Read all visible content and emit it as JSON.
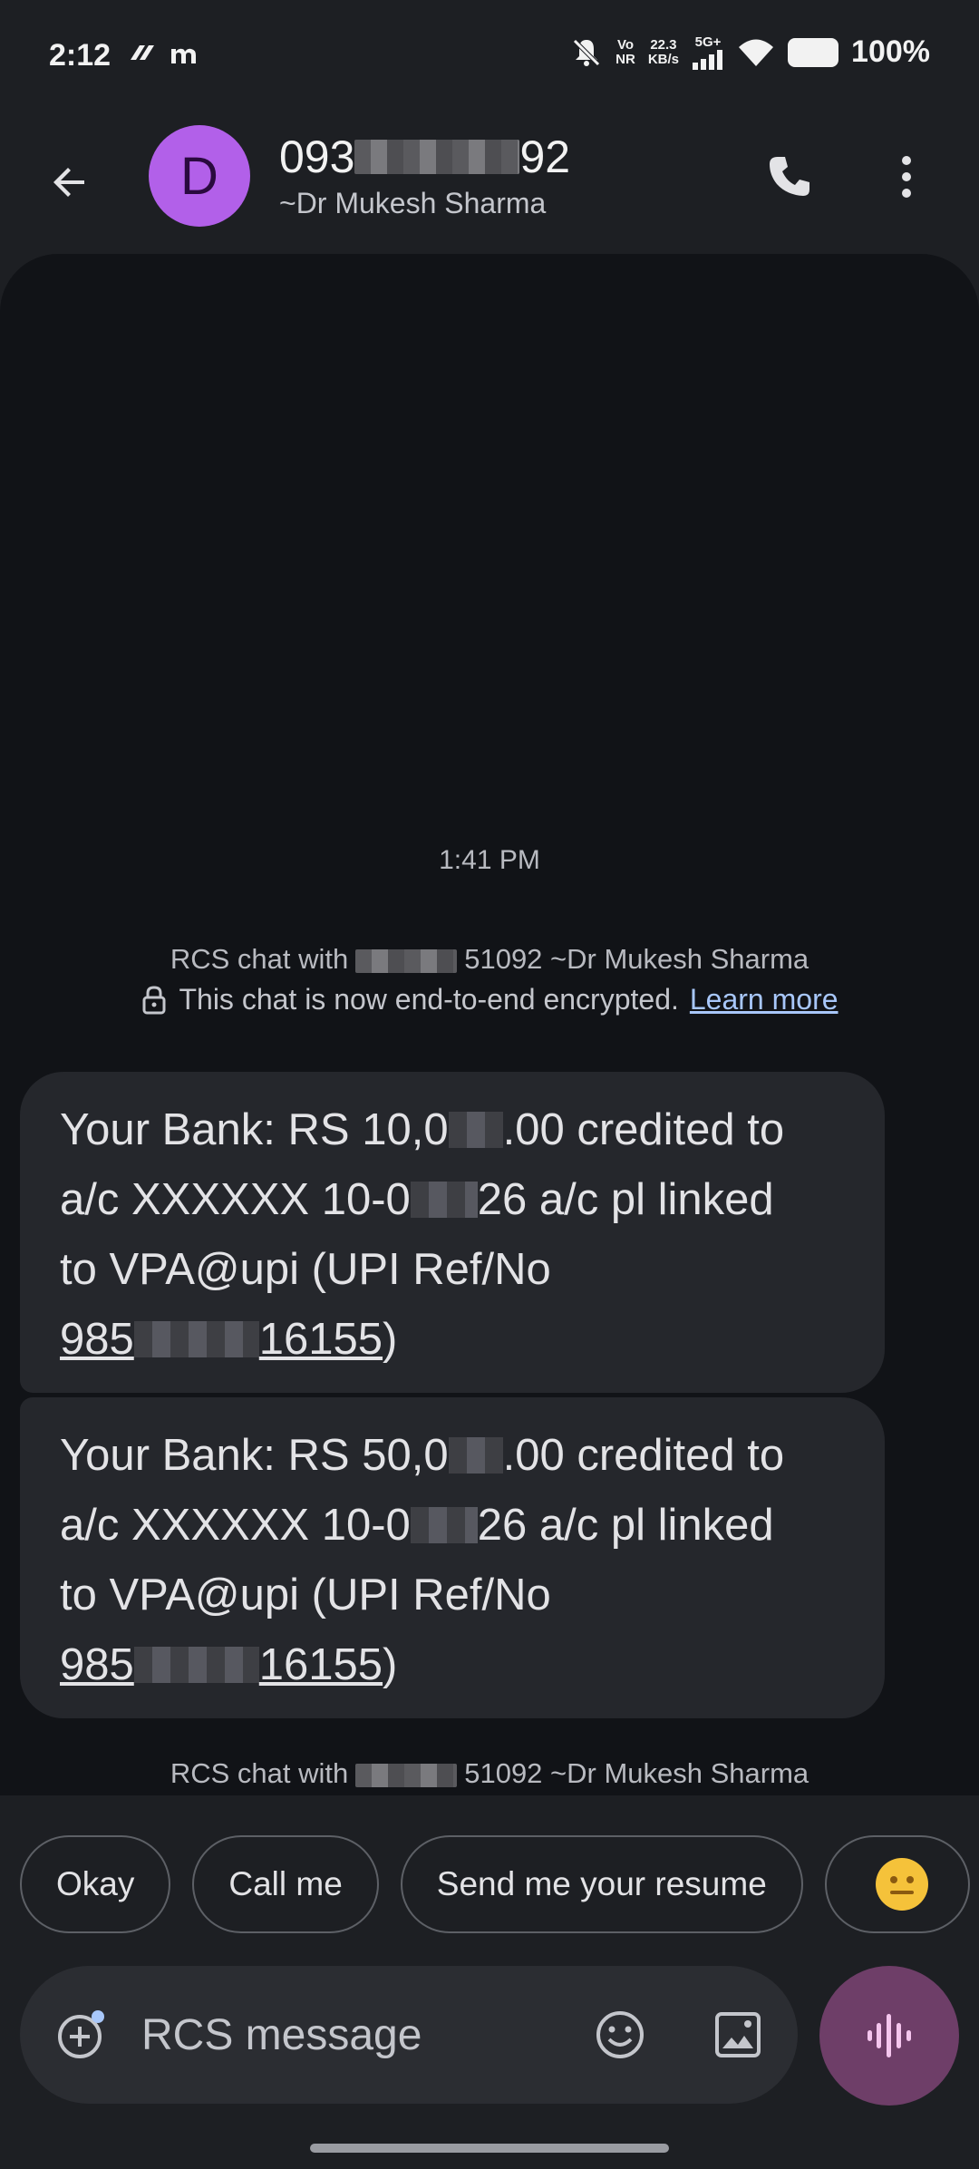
{
  "status_bar": {
    "time": "2:12",
    "network_vo": "Vo",
    "network_nr": "NR",
    "speed_value": "22.3",
    "speed_unit": "KB/s",
    "network_type": "5G+",
    "battery": "100%"
  },
  "header": {
    "avatar_letter": "D",
    "number_prefix": "093",
    "number_suffix": "92",
    "contact_name": "~Dr Mukesh Sharma"
  },
  "conversation": {
    "timestamp": "1:41 PM",
    "rcs_info": {
      "prefix": "RCS chat with",
      "suffix": "51092 ~Dr Mukesh Sharma"
    },
    "encryption_text": "This chat is now end-to-end encrypted.",
    "learn_more": "Learn more",
    "messages": [
      {
        "line1_a": "Your Bank: RS 10,0",
        "line1_b": ".00 credited to",
        "line2_a": "a/c XXXXXX 10-0",
        "line2_b": "26 a/c pl linked",
        "line3": "to VPA@upi (UPI Ref/No",
        "ref_prefix": "985",
        "ref_suffix": "16155",
        "ref_close": ")"
      },
      {
        "line1_a": "Your Bank: RS 50,0",
        "line1_b": ".00 credited to",
        "line2_a": "a/c XXXXXX 10-0",
        "line2_b": "26 a/c pl linked",
        "line3": "to VPA@upi (UPI Ref/No",
        "ref_prefix": "985",
        "ref_suffix": "16155",
        "ref_close": ")"
      }
    ]
  },
  "suggestions": [
    "Okay",
    "Call me",
    "Send me your resume"
  ],
  "compose": {
    "placeholder": "RCS message"
  },
  "colors": {
    "background": "#1d1f23",
    "conversation_bg": "#111317",
    "bubble": "#25272c",
    "avatar": "#b260e9",
    "link": "#a8c7fa",
    "voice_button": "#6e3e68"
  }
}
